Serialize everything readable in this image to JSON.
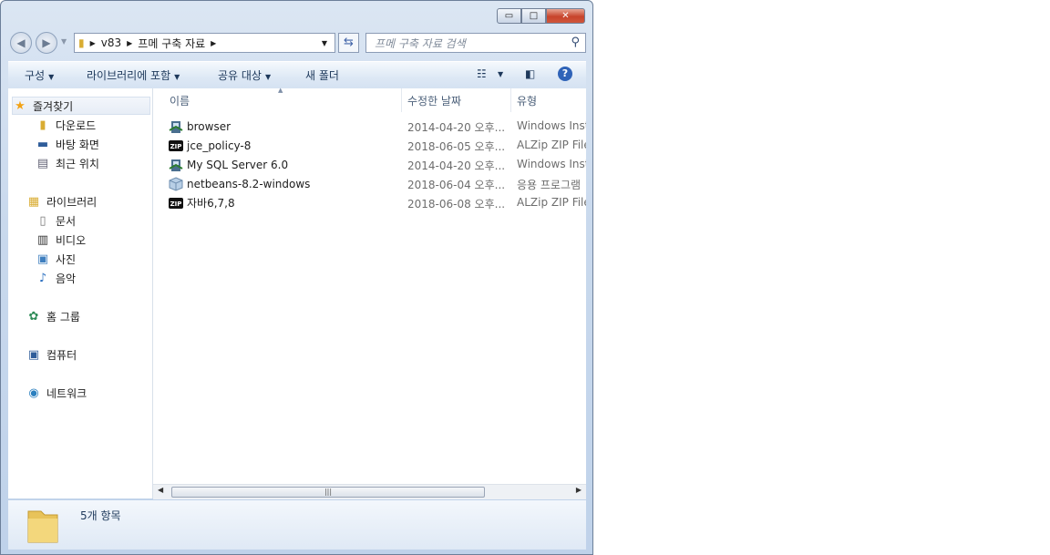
{
  "window": {
    "controls": {
      "minimize": "▭",
      "maximize": "□",
      "close": "✕"
    }
  },
  "address": {
    "crumbs": [
      "v83",
      "프메 구축 자료"
    ]
  },
  "search": {
    "placeholder": "프메 구축 자료 검색"
  },
  "toolbar": {
    "organize": "구성",
    "include_library": "라이브러리에 포함",
    "share": "공유 대상",
    "new_folder": "새 폴더"
  },
  "nav": {
    "favorites": "즐겨찾기",
    "downloads": "다운로드",
    "desktop": "바탕 화면",
    "recent": "최근 위치",
    "libraries": "라이브러리",
    "documents": "문서",
    "videos": "비디오",
    "pictures": "사진",
    "music": "음악",
    "homegroup": "홈 그룹",
    "computer": "컴퓨터",
    "network": "네트워크"
  },
  "columns": {
    "name": "이름",
    "date": "수정한 날짜",
    "type": "유형"
  },
  "files": [
    {
      "name": "browser",
      "date": "2014-04-20 오후...",
      "type": "Windows Insta",
      "icon": "installer-icon"
    },
    {
      "name": "jce_policy-8",
      "date": "2018-06-05 오후...",
      "type": "ALZip ZIP File",
      "icon": "zip-icon"
    },
    {
      "name": "My SQL Server 6.0",
      "date": "2014-04-20 오후...",
      "type": "Windows Insta",
      "icon": "installer-icon"
    },
    {
      "name": "netbeans-8.2-windows",
      "date": "2018-06-04 오후...",
      "type": "응용 프로그램",
      "icon": "application-icon"
    },
    {
      "name": "자바6,7,8",
      "date": "2018-06-08 오후...",
      "type": "ALZip ZIP File",
      "icon": "zip-icon"
    }
  ],
  "status": {
    "count": "5개 항목"
  },
  "colors": {
    "folder": "#e8c35a",
    "accent": "#1e395b"
  }
}
